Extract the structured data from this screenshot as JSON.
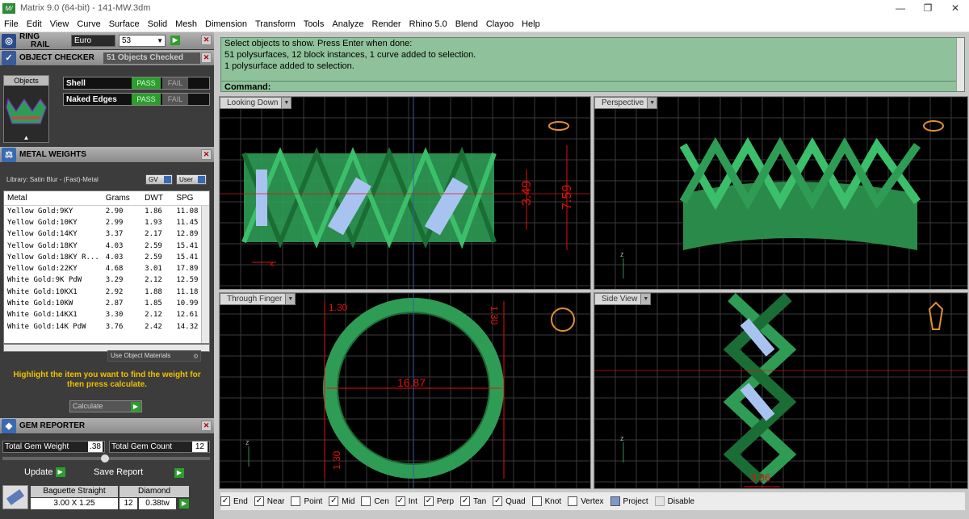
{
  "window": {
    "title": "Matrix 9.0 (64-bit) - 141-MW.3dm",
    "app_icon": "matrix-app-icon",
    "controls": [
      "—",
      "❐",
      "✕"
    ]
  },
  "menu": [
    "File",
    "Edit",
    "View",
    "Curve",
    "Surface",
    "Solid",
    "Mesh",
    "Dimension",
    "Transform",
    "Tools",
    "Analyze",
    "Render",
    "Rhino 5.0",
    "Blend",
    "Clayoo",
    "Help"
  ],
  "ring_rail": {
    "title_line1": "RING",
    "title_line2": "RAIL",
    "size_system": "Euro",
    "size": "53"
  },
  "object_checker": {
    "title": "OBJECT CHECKER",
    "status": "51 Objects Checked",
    "objects_tab": "Objects",
    "checks": [
      {
        "label": "Shell",
        "pass": "PASS",
        "fail": "FAIL"
      },
      {
        "label": "Naked Edges",
        "pass": "PASS",
        "fail": "FAIL"
      }
    ]
  },
  "metal_weights": {
    "title": "METAL WEIGHTS",
    "library": "Library: Satin Blur - (Fast)-Metal",
    "gv": "GV",
    "user": "User",
    "columns": [
      "Metal",
      "Grams",
      "DWT",
      "SPG"
    ],
    "rows": [
      [
        "Yellow Gold:9KY",
        "2.90",
        "1.86",
        "11.08"
      ],
      [
        "Yellow Gold:10KY",
        "2.99",
        "1.93",
        "11.45"
      ],
      [
        "Yellow Gold:14KY",
        "3.37",
        "2.17",
        "12.89"
      ],
      [
        "Yellow Gold:18KY",
        "4.03",
        "2.59",
        "15.41"
      ],
      [
        "Yellow Gold:18KY R...",
        "4.03",
        "2.59",
        "15.41"
      ],
      [
        "Yellow Gold:22KY",
        "4.68",
        "3.01",
        "17.89"
      ],
      [
        "White Gold:9K PdW",
        "3.29",
        "2.12",
        "12.59"
      ],
      [
        "White Gold:10KX1",
        "2.92",
        "1.88",
        "11.18"
      ],
      [
        "White Gold:10KW",
        "2.87",
        "1.85",
        "10.99"
      ],
      [
        "White Gold:14KX1",
        "3.30",
        "2.12",
        "12.61"
      ],
      [
        "White Gold:14K PdW",
        "3.76",
        "2.42",
        "14.32"
      ]
    ],
    "use_object_materials": "Use Object Materials",
    "hint": "Highlight the item you want to find the weight for then press calculate.",
    "calculate": "Calculate"
  },
  "gem_reporter": {
    "title": "GEM REPORTER",
    "total_weight_label": "Total Gem Weight",
    "total_weight": ".38",
    "total_count_label": "Total Gem Count",
    "total_count": "12",
    "update": "Update",
    "save_report": "Save Report",
    "gem": {
      "cut": "Baguette Straight",
      "type": "Diamond",
      "size": "3.00 X 1.25",
      "count": "12",
      "tw": "0.38tw"
    }
  },
  "command": {
    "lines": [
      "Select objects to show. Press Enter when done:",
      "51 polysurfaces, 12 block instances, 1 curve added to selection.",
      "1 polysurface added to selection."
    ],
    "prompt": "Command:"
  },
  "viewports": {
    "top": {
      "label": "Looking Down",
      "dim1": "3.49",
      "dim2": "7.59"
    },
    "perspective": {
      "label": "Perspective"
    },
    "front": {
      "label": "Through Finger",
      "dim_width": "16.87",
      "dim_top_left": "1.30",
      "dim_top_right": "1.30",
      "dim_bottom": "1.30"
    },
    "side": {
      "label": "Side View",
      "dim_bottom": "3.06"
    }
  },
  "axes": {
    "x": "x",
    "y": "y",
    "z": "z"
  },
  "osnaps": [
    {
      "label": "End",
      "checked": true
    },
    {
      "label": "Near",
      "checked": true
    },
    {
      "label": "Point",
      "checked": false
    },
    {
      "label": "Mid",
      "checked": true
    },
    {
      "label": "Cen",
      "checked": false
    },
    {
      "label": "Int",
      "checked": true
    },
    {
      "label": "Perp",
      "checked": true
    },
    {
      "label": "Tan",
      "checked": true
    },
    {
      "label": "Quad",
      "checked": true
    },
    {
      "label": "Knot",
      "checked": false
    },
    {
      "label": "Vertex",
      "checked": false
    },
    {
      "label": "Project",
      "checked": false
    },
    {
      "label": "Disable",
      "checked": false
    }
  ],
  "colors": {
    "ring_green": "#2f9c55",
    "stone_blue": "#a9c3f0",
    "prong_purple": "#7a35c8",
    "dim_red": "#e01010",
    "grid": "#3a3a3a",
    "cmd_bg": "#8fc29a"
  }
}
